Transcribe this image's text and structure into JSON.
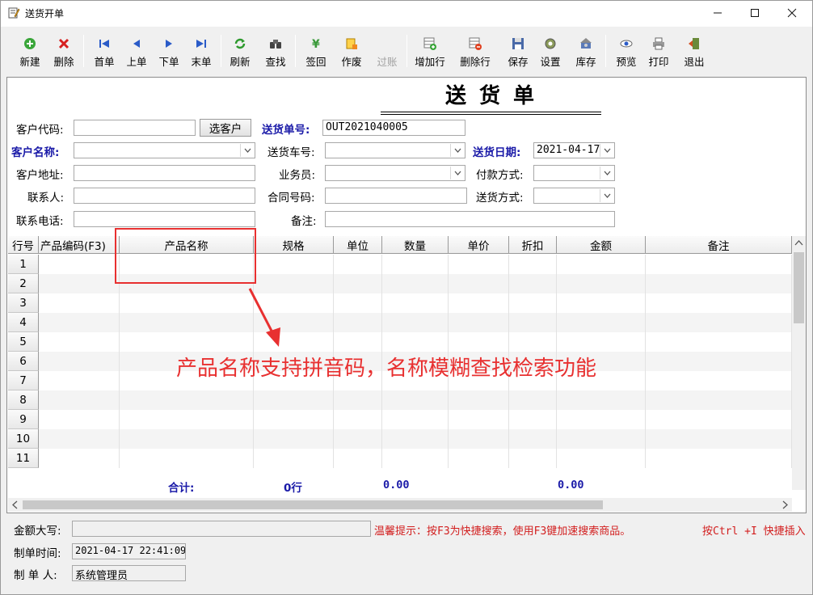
{
  "window": {
    "title": "送货开单"
  },
  "toolbar": {
    "new": "新建",
    "delete": "删除",
    "first": "首单",
    "prev": "上单",
    "next": "下单",
    "last": "末单",
    "refresh": "刷新",
    "find": "查找",
    "sign_back": "签回",
    "void": "作废",
    "post": "过账",
    "add_row": "增加行",
    "delete_row": "删除行",
    "save": "保存",
    "settings": "设置",
    "stock": "库存",
    "preview": "预览",
    "print": "打印",
    "exit": "退出"
  },
  "doc": {
    "title": "送货单"
  },
  "form": {
    "customer_code_label": "客户代码:",
    "customer_code": "",
    "select_customer_btn": "选客户",
    "delivery_no_label": "送货单号:",
    "delivery_no": "OUT2021040005",
    "customer_name_label": "客户名称:",
    "customer_name": "",
    "vehicle_label": "送货车号:",
    "vehicle": "",
    "delivery_date_label": "送货日期:",
    "delivery_date": "2021-04-17",
    "address_label": "客户地址:",
    "address": "",
    "salesman_label": "业务员:",
    "salesman": "",
    "payment_label": "付款方式:",
    "payment": "",
    "contact_label": "联系人:",
    "contact": "",
    "contract_label": "合同号码:",
    "contract": "",
    "ship_method_label": "送货方式:",
    "ship_method": "",
    "phone_label": "联系电话:",
    "phone": "",
    "remark_label": "备注:",
    "remark": ""
  },
  "grid": {
    "headers": [
      "行号",
      "产品编码(F3)",
      "产品名称",
      "规格",
      "单位",
      "数量",
      "单价",
      "折扣",
      "金额",
      "备注"
    ],
    "rows": [
      "1",
      "2",
      "3",
      "4",
      "5",
      "6",
      "7",
      "8",
      "9",
      "10",
      "11"
    ]
  },
  "totals": {
    "label": "合计:",
    "rows": "0行",
    "qty": "0.00",
    "amount": "0.00"
  },
  "annotation": {
    "text": "产品名称支持拼音码，名称模糊查找检索功能"
  },
  "footer": {
    "amount_words_label": "金额大写:",
    "amount_words": "",
    "hint": "温馨提示：按F3为快捷搜索，使用F3键加速搜索商品。",
    "hint2": "按Ctrl +I 快捷插入",
    "created_time_label": "制单时间:",
    "created_time": "2021-04-17 22:41:09",
    "creator_label": "制 单 人:",
    "creator": "系统管理员"
  }
}
